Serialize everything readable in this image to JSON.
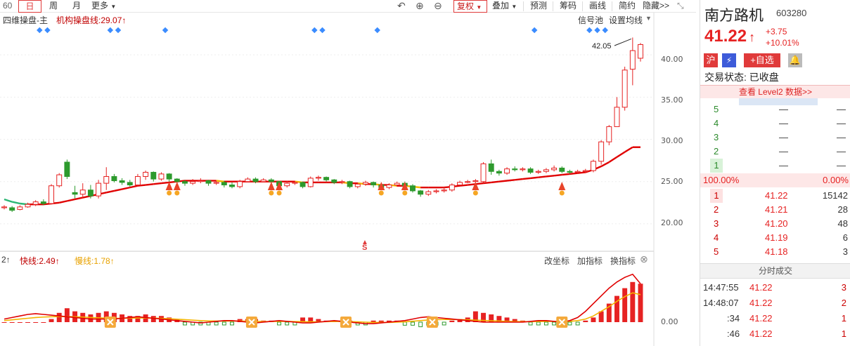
{
  "toolbar": {
    "period": "60",
    "tabs": [
      "日",
      "周",
      "月"
    ],
    "more": "更多",
    "fuquan": "复权",
    "overlay": "叠加",
    "predict": "预测",
    "chips": "筹码",
    "draw": "画线",
    "simple": "简约",
    "hide": "隐藏>>"
  },
  "main_chart": {
    "indicator_name": "四维操盘-主",
    "indicator_line": "机构操盘线:29.07↑",
    "signal_pool": "信号池",
    "set_ma": "设置均线",
    "high_label": "42.05",
    "sell_marker": "S",
    "y_ticks": [
      "40.00",
      "35.00",
      "30.00",
      "25.00",
      "20.00"
    ],
    "ylim": [
      17,
      44
    ],
    "colors": {
      "up": "#e62222",
      "down": "#2d9a2d",
      "line_red": "#e00000",
      "line_yellow": "#f4b400",
      "signal": "#3b8cff"
    }
  },
  "sub_chart": {
    "prefix": "2↑",
    "fast_label": "快线:2.49↑",
    "slow_label": "慢线:1.78↑",
    "change_coord": "改坐标",
    "add_indicator": "加指标",
    "swap_indicator": "换指标",
    "zero_tick": "0.00"
  },
  "chart_data": {
    "type": "candlestick",
    "candles": [
      [
        21.9,
        22.0,
        21.7,
        22.2
      ],
      [
        21.9,
        21.6,
        21.4,
        22.1
      ],
      [
        21.7,
        22.0,
        21.6,
        22.2
      ],
      [
        22.0,
        22.3,
        21.9,
        22.5
      ],
      [
        22.3,
        22.6,
        22.1,
        22.8
      ],
      [
        22.6,
        22.4,
        22.2,
        22.9
      ],
      [
        22.4,
        24.5,
        22.3,
        24.7
      ],
      [
        24.5,
        25.8,
        24.3,
        26.0
      ],
      [
        27.3,
        25.6,
        25.3,
        27.6
      ],
      [
        23.7,
        23.5,
        23.0,
        24.5
      ],
      [
        23.5,
        24.0,
        23.2,
        24.8
      ],
      [
        24.0,
        23.3,
        23.0,
        24.6
      ],
      [
        23.3,
        24.8,
        23.0,
        25.2
      ],
      [
        24.8,
        25.6,
        24.0,
        26.7
      ],
      [
        25.6,
        25.1,
        24.9,
        25.9
      ],
      [
        25.1,
        24.9,
        24.6,
        25.4
      ],
      [
        24.9,
        24.6,
        24.4,
        25.2
      ],
      [
        24.6,
        25.6,
        24.4,
        25.9
      ],
      [
        25.6,
        26.1,
        25.2,
        26.3
      ],
      [
        26.1,
        25.3,
        25.0,
        26.2
      ],
      [
        25.3,
        25.9,
        25.1,
        26.1
      ],
      [
        25.9,
        25.3,
        25.0,
        26.0
      ],
      [
        25.3,
        25.0,
        24.7,
        25.4
      ],
      [
        25.0,
        24.8,
        24.5,
        25.2
      ],
      [
        24.8,
        25.0,
        24.6,
        25.3
      ],
      [
        25.0,
        25.1,
        24.8,
        25.4
      ],
      [
        25.1,
        24.8,
        24.5,
        25.2
      ],
      [
        24.8,
        24.9,
        24.6,
        25.1
      ],
      [
        24.9,
        24.6,
        24.3,
        25.1
      ],
      [
        24.6,
        24.4,
        24.2,
        24.9
      ],
      [
        24.4,
        25.0,
        24.2,
        25.2
      ],
      [
        25.0,
        25.3,
        24.9,
        25.5
      ],
      [
        25.3,
        25.0,
        24.8,
        25.5
      ],
      [
        25.0,
        25.2,
        24.9,
        25.4
      ],
      [
        25.2,
        25.0,
        24.8,
        25.4
      ],
      [
        25.0,
        24.5,
        24.3,
        25.1
      ],
      [
        24.5,
        24.8,
        24.3,
        25.0
      ],
      [
        24.8,
        24.9,
        24.6,
        25.1
      ],
      [
        24.9,
        24.4,
        24.2,
        25.0
      ],
      [
        24.4,
        25.4,
        24.3,
        25.6
      ],
      [
        25.4,
        25.5,
        25.1,
        25.7
      ],
      [
        25.5,
        25.2,
        25.0,
        25.6
      ],
      [
        25.2,
        24.9,
        24.7,
        25.3
      ],
      [
        24.9,
        25.0,
        24.7,
        25.2
      ],
      [
        25.0,
        24.4,
        24.2,
        25.1
      ],
      [
        24.4,
        24.7,
        24.2,
        24.9
      ],
      [
        24.7,
        24.9,
        24.5,
        25.1
      ],
      [
        24.9,
        24.6,
        24.3,
        25.0
      ],
      [
        24.6,
        24.3,
        24.0,
        24.8
      ],
      [
        24.3,
        24.6,
        24.1,
        24.8
      ],
      [
        24.6,
        24.8,
        24.4,
        25.0
      ],
      [
        24.8,
        24.5,
        24.2,
        25.0
      ],
      [
        24.5,
        23.9,
        23.7,
        24.7
      ],
      [
        23.9,
        23.5,
        23.2,
        24.0
      ],
      [
        23.5,
        23.8,
        23.3,
        24.0
      ],
      [
        23.8,
        23.9,
        23.6,
        24.1
      ],
      [
        23.9,
        24.0,
        23.7,
        24.2
      ],
      [
        24.0,
        24.6,
        23.8,
        24.8
      ],
      [
        24.6,
        24.9,
        24.5,
        25.1
      ],
      [
        24.9,
        25.0,
        24.8,
        25.2
      ],
      [
        25.0,
        25.1,
        24.8,
        25.3
      ],
      [
        25.0,
        27.1,
        24.9,
        27.3
      ],
      [
        27.1,
        26.2,
        25.8,
        27.6
      ],
      [
        26.2,
        26.0,
        25.7,
        26.4
      ],
      [
        26.0,
        26.5,
        25.8,
        26.7
      ],
      [
        26.5,
        26.4,
        26.2,
        26.8
      ],
      [
        26.4,
        26.5,
        26.2,
        26.7
      ],
      [
        26.5,
        26.1,
        25.9,
        26.7
      ],
      [
        26.1,
        26.2,
        25.9,
        26.4
      ],
      [
        26.2,
        26.4,
        26.0,
        26.6
      ],
      [
        26.4,
        26.6,
        26.2,
        26.9
      ],
      [
        26.6,
        26.2,
        26.0,
        26.8
      ],
      [
        26.2,
        26.1,
        25.9,
        26.4
      ],
      [
        26.1,
        26.2,
        25.9,
        26.4
      ],
      [
        26.2,
        26.3,
        26.0,
        26.5
      ],
      [
        26.3,
        27.4,
        26.1,
        27.6
      ],
      [
        27.4,
        29.7,
        27.0,
        29.9
      ],
      [
        29.7,
        31.5,
        29.3,
        31.7
      ],
      [
        31.5,
        33.8,
        32.6,
        35.0
      ],
      [
        33.8,
        38.2,
        33.4,
        38.6
      ],
      [
        38.3,
        40.5,
        36.4,
        42.05
      ],
      [
        39.6,
        41.22,
        39.2,
        41.4
      ]
    ],
    "series": [
      {
        "name": "机构操盘线",
        "values": [
          22.9,
          22.6,
          22.4,
          22.3,
          22.3,
          22.3,
          22.4,
          22.5,
          22.7,
          22.9,
          23.1,
          23.3,
          23.5,
          23.7,
          23.9,
          24.1,
          24.3,
          24.5,
          24.6,
          24.7,
          24.8,
          24.9,
          25.0,
          25.1,
          25.1,
          25.1,
          25.1,
          25.1,
          25.0,
          25.0,
          25.0,
          25.0,
          25.0,
          25.0,
          25.0,
          25.0,
          25.0,
          25.0,
          24.9,
          24.9,
          24.9,
          24.9,
          24.9,
          24.9,
          24.8,
          24.8,
          24.7,
          24.7,
          24.6,
          24.6,
          24.5,
          24.5,
          24.4,
          24.3,
          24.3,
          24.3,
          24.3,
          24.4,
          24.5,
          24.6,
          24.7,
          24.8,
          24.9,
          25.0,
          25.1,
          25.2,
          25.3,
          25.4,
          25.5,
          25.6,
          25.7,
          25.8,
          25.9,
          26.0,
          26.1,
          26.4,
          26.8,
          27.3,
          27.9,
          28.5,
          29.07,
          29.07
        ]
      }
    ],
    "macd_bars": [
      0,
      0,
      0,
      0,
      0,
      0,
      0.2,
      0.6,
      0.9,
      0.7,
      0.6,
      0.5,
      0.6,
      0.7,
      0.6,
      0.5,
      0.4,
      0.4,
      0.5,
      0.4,
      0.4,
      0.3,
      0.2,
      -0.1,
      -0.1,
      -0.1,
      -0.1,
      -0.1,
      -0.1,
      -0.1,
      0.2,
      0.2,
      0.2,
      0.1,
      0.1,
      -0.1,
      -0.1,
      -0.1,
      0.3,
      0.3,
      0.2,
      0.1,
      0.1,
      0.1,
      0.1,
      -0.1,
      -0.1,
      0.1,
      0.1,
      0.1,
      0.1,
      -0.2,
      -0.2,
      -0.3,
      -0.2,
      -0.2,
      -0.1,
      0.1,
      0.2,
      0.3,
      0.7,
      0.6,
      0.5,
      0.4,
      0.3,
      0.2,
      0.1,
      -0.1,
      -0.1,
      -0.1,
      -0.1,
      -0.1,
      -0.1,
      -0.1,
      0.1,
      0.3,
      0.7,
      1.2,
      1.7,
      2.2,
      2.6,
      2.49
    ],
    "fast_line": [
      0.2,
      0.3,
      0.4,
      0.5,
      0.55,
      0.5,
      0.45,
      0.4,
      0.35,
      0.3,
      0.25,
      0.2,
      0.2,
      0.2,
      0.2,
      0.25,
      0.3,
      0.35,
      0.3,
      0.25,
      0.2,
      0.15,
      0.1,
      0.05,
      0,
      -0.05,
      0,
      0.05,
      0.1,
      0.1,
      0.05,
      0,
      -0.05,
      0,
      0.05,
      0.1,
      0.05,
      0,
      -0.05,
      -0.05,
      0,
      0.05,
      0.1,
      0.05,
      0,
      -0.05,
      -0.1,
      -0.1,
      -0.05,
      0,
      0.05,
      0.1,
      0.2,
      0.3,
      0.35,
      0.3,
      0.25,
      0.2,
      0.15,
      0.1,
      0.05,
      0,
      0,
      0,
      0,
      0,
      0,
      0.05,
      0.1,
      0.1,
      0.05,
      0,
      0.1,
      0.3,
      0.7,
      1.2,
      1.7,
      2.2,
      2.6,
      2.9,
      3.1,
      2.49
    ],
    "slow_line": [
      0.1,
      0.15,
      0.2,
      0.25,
      0.3,
      0.33,
      0.35,
      0.36,
      0.36,
      0.35,
      0.33,
      0.3,
      0.28,
      0.26,
      0.25,
      0.25,
      0.26,
      0.27,
      0.27,
      0.26,
      0.24,
      0.22,
      0.19,
      0.16,
      0.13,
      0.1,
      0.08,
      0.07,
      0.07,
      0.07,
      0.07,
      0.06,
      0.05,
      0.04,
      0.04,
      0.05,
      0.05,
      0.04,
      0.03,
      0.02,
      0.02,
      0.03,
      0.04,
      0.04,
      0.03,
      0.02,
      0,
      -0.02,
      -0.02,
      -0.02,
      0,
      0.02,
      0.06,
      0.1,
      0.14,
      0.16,
      0.17,
      0.17,
      0.16,
      0.15,
      0.13,
      0.11,
      0.09,
      0.07,
      0.05,
      0.04,
      0.03,
      0.03,
      0.04,
      0.05,
      0.05,
      0.04,
      0.05,
      0.1,
      0.2,
      0.4,
      0.7,
      1.0,
      1.35,
      1.65,
      1.9,
      1.78
    ]
  },
  "stock": {
    "name": "南方路机",
    "code": "603280",
    "price": "41.22",
    "arrow": "↑",
    "change": "+3.75",
    "change_pct": "+10.01%",
    "btn_exchange": "沪",
    "btn_fav": "+自选",
    "trade_status": "交易状态: 已收盘",
    "level2": "查看 Level2 数据>>",
    "ask_levels": [
      {
        "lvl": "5",
        "price": "—",
        "vol": "—"
      },
      {
        "lvl": "4",
        "price": "—",
        "vol": "—"
      },
      {
        "lvl": "3",
        "price": "—",
        "vol": "—"
      },
      {
        "lvl": "2",
        "price": "—",
        "vol": "—"
      },
      {
        "lvl": "1",
        "price": "—",
        "vol": "—"
      }
    ],
    "ratio_left": "100.00%",
    "ratio_right": "0.00%",
    "bid_levels": [
      {
        "lvl": "1",
        "price": "41.22",
        "vol": "15142"
      },
      {
        "lvl": "2",
        "price": "41.21",
        "vol": "28"
      },
      {
        "lvl": "3",
        "price": "41.20",
        "vol": "48"
      },
      {
        "lvl": "4",
        "price": "41.19",
        "vol": "6"
      },
      {
        "lvl": "5",
        "price": "41.18",
        "vol": "3"
      }
    ],
    "ticks_title": "分时成交",
    "ticks": [
      {
        "time": "14:47:55",
        "price": "41.22",
        "vol": "3"
      },
      {
        "time": "14:48:07",
        "price": "41.22",
        "vol": "2"
      },
      {
        "time": ":34",
        "price": "41.22",
        "vol": "1"
      },
      {
        "time": ":46",
        "price": "41.22",
        "vol": "1"
      }
    ]
  }
}
